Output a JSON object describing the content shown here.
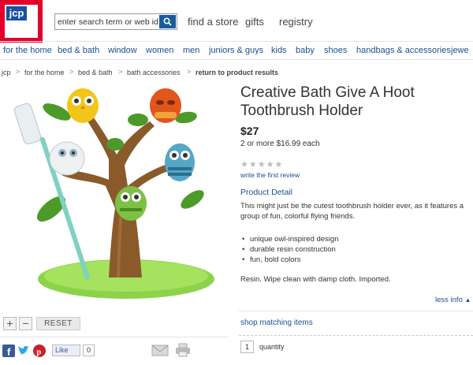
{
  "logo": {
    "text": "jcp"
  },
  "search": {
    "placeholder": "enter search term or web id"
  },
  "header": {
    "links": [
      "find a store",
      "gifts",
      "registry"
    ]
  },
  "nav": {
    "items": [
      "for the home",
      "bed & bath",
      "window",
      "women",
      "men",
      "juniors & guys",
      "kids",
      "baby",
      "shoes",
      "handbags & accessories",
      "jewe"
    ]
  },
  "breadcrumb": {
    "items": [
      "jcp",
      "for the home",
      "bed & bath",
      "bath accessories",
      "return to product results"
    ]
  },
  "controls": {
    "reset": "RESET",
    "zoom_in": "+",
    "zoom_out": "−"
  },
  "social": {
    "like_label": "Like",
    "like_count": "0"
  },
  "product": {
    "title": "Creative Bath Give A Hoot Toothbrush Holder",
    "price": "$27",
    "multi_price": "2 or more $16.99 each",
    "rating_stars": 0,
    "write_review": "write the first review",
    "detail_heading": "Product Detail",
    "description": "This might just be the cutest toothbrush holder ever, as it features a group of fun, colorful flying friends.",
    "features": [
      "unique owl-inspired design",
      "durable resin construction",
      "fun, bold colors"
    ],
    "care": "Resin. Wipe clean with damp cloth. Imported.",
    "less_info": "less info",
    "shop_matching": "shop matching items",
    "quantity_value": "1",
    "quantity_label": "quantity"
  },
  "colors": {
    "brand_red": "#e4002b",
    "brand_blue": "#1a4fa3",
    "link_blue": "#1a4f8f"
  }
}
